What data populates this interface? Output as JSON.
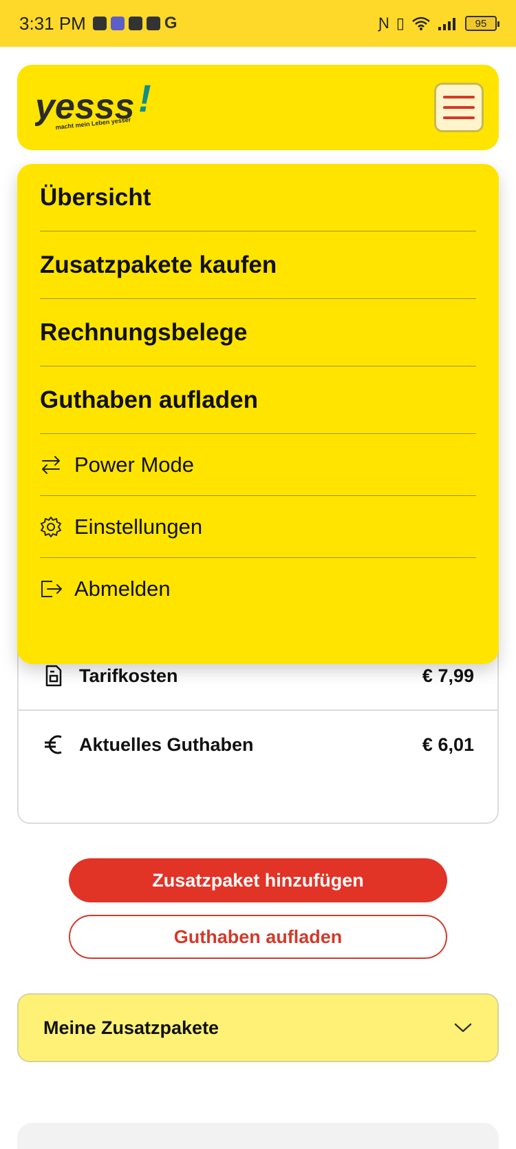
{
  "status_bar": {
    "time": "3:31 PM",
    "notification_g": "G",
    "battery": "95"
  },
  "header": {
    "logo_text": "yesss!",
    "logo_tagline": "macht mein Leben yesser"
  },
  "menu": {
    "primary": [
      {
        "label": "Übersicht"
      },
      {
        "label": "Zusatzpakete kaufen"
      },
      {
        "label": "Rechnungsbelege"
      },
      {
        "label": "Guthaben aufladen"
      }
    ],
    "secondary": [
      {
        "label": "Power Mode",
        "icon": "swap-arrows-icon"
      },
      {
        "label": "Einstellungen",
        "icon": "gear-icon"
      },
      {
        "label": "Abmelden",
        "icon": "logout-icon"
      }
    ]
  },
  "info": {
    "rows": [
      {
        "label": "Tarifkosten",
        "value": "€ 7,99",
        "icon": "document-icon"
      },
      {
        "label": "Aktuelles Guthaben",
        "value": "€ 6,01",
        "icon": "euro-icon"
      }
    ]
  },
  "actions": {
    "primary_label": "Zusatzpaket hinzufügen",
    "secondary_label": "Guthaben aufladen"
  },
  "accordion": {
    "title": "Meine Zusatzpakete"
  },
  "colors": {
    "brand_yellow": "#ffe400",
    "status_yellow": "#ffd92a",
    "accent_red": "#e13326",
    "accordion_yellow": "#fff176"
  }
}
